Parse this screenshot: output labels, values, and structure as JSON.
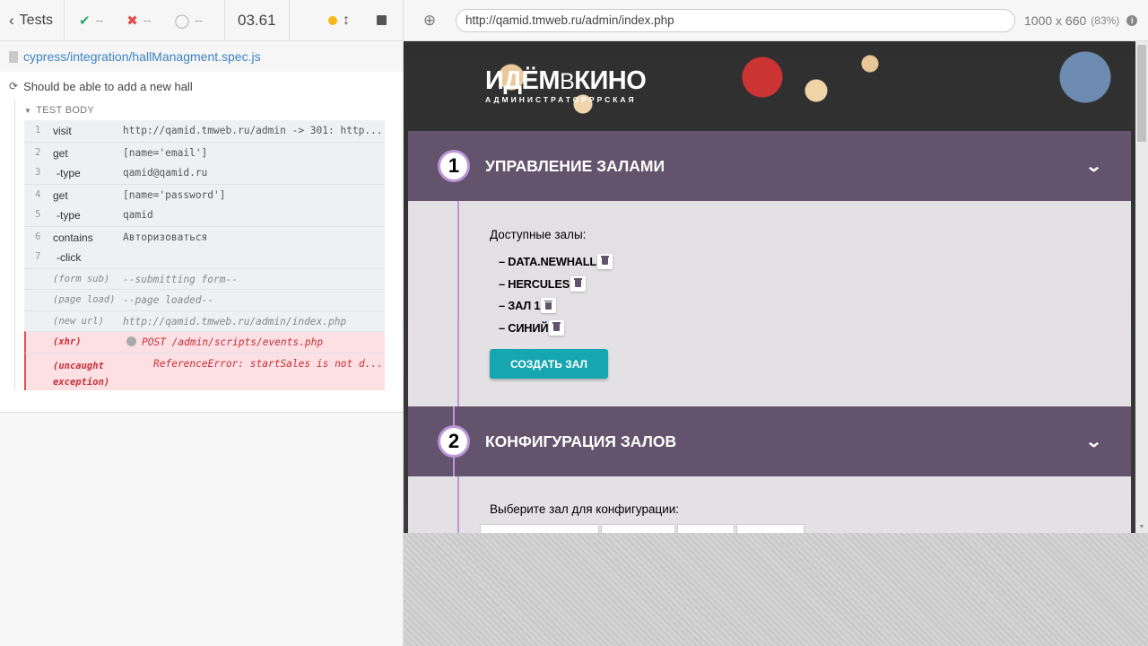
{
  "runner": {
    "back_label": "Tests",
    "passed": "--",
    "failed": "--",
    "pending": "--",
    "duration": "03.61",
    "spec_path": "cypress/integration/hallManagment.spec.js",
    "test_title": "Should be able to add a new hall",
    "body_label": "TEST BODY",
    "commands": [
      {
        "num": "1",
        "name": "visit",
        "msg": "http://qamid.tmweb.ru/admin -> 301: http..."
      },
      {
        "num": "2",
        "name": "get",
        "msg": "[name='email']"
      },
      {
        "num": "3",
        "name": "-type",
        "msg": "qamid@qamid.ru"
      },
      {
        "num": "4",
        "name": "get",
        "msg": "[name='password']"
      },
      {
        "num": "5",
        "name": "-type",
        "msg": "qamid"
      },
      {
        "num": "6",
        "name": "contains",
        "msg": "Авторизоваться"
      },
      {
        "num": "7",
        "name": "-click",
        "msg": ""
      },
      {
        "num": "",
        "name": "(form sub)",
        "msg": "--submitting form--"
      },
      {
        "num": "",
        "name": "(page load)",
        "msg": "--page loaded--"
      },
      {
        "num": "",
        "name": "(new url)",
        "msg": "http://qamid.tmweb.ru/admin/index.php"
      },
      {
        "num": "",
        "name": "(xhr)",
        "msg": "POST /admin/scripts/events.php"
      },
      {
        "num": "",
        "name": "(uncaught",
        "name2": "exception)",
        "msg": "ReferenceError: startSales is not d..."
      }
    ]
  },
  "preview": {
    "url": "http://qamid.tmweb.ru/admin/index.php",
    "viewport_size": "1000 x 660",
    "viewport_pct": "(83%)"
  },
  "app": {
    "logo_part1": "ИДЁМ",
    "logo_part2": "В",
    "logo_part3": "КИНО",
    "logo_sub": "АДМИНИСТРАТОРРРСКАЯ",
    "section1": {
      "step": "1",
      "title": "УПРАВЛЕНИЕ ЗАЛАМИ",
      "halls_label": "Доступные залы:",
      "halls": [
        "– DATA.NEWHALL",
        "– HERCULES",
        "– ЗАЛ 1",
        "– СИНИЙ"
      ],
      "create_button": "СОЗДАТЬ ЗАЛ"
    },
    "section2": {
      "step": "2",
      "title": "КОНФИГУРАЦИЯ ЗАЛОВ",
      "config_label": "Выберите зал для конфигурации:"
    },
    "colors": {
      "header": "#63536c",
      "accent_button": "#16a6af",
      "timeline": "#bb96d6"
    }
  }
}
